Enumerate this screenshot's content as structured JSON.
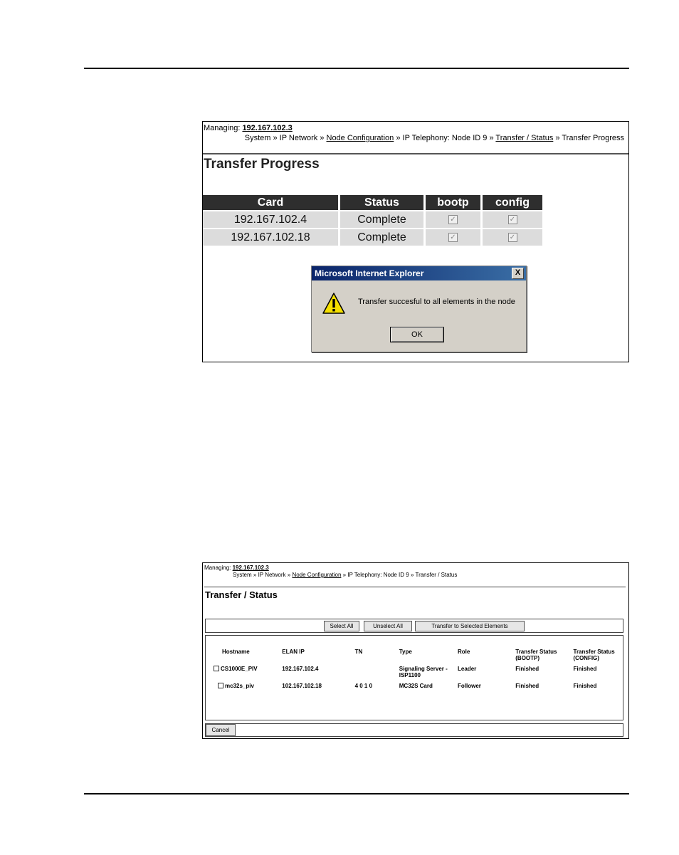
{
  "shot1": {
    "managing_label": "Managing:",
    "managing_ip": "192.167.102.3",
    "crumbs": {
      "system": "System »",
      "ipnetwork": "IP Network »",
      "nodeconfig": "Node Configuration",
      "sep1": "»",
      "iptel": "IP Telephony: Node ID 9 »",
      "transferstatus": "Transfer / Status",
      "sep2": "»",
      "current": "Transfer Progress"
    },
    "title": "Transfer Progress",
    "columns": [
      "Card",
      "Status",
      "bootp",
      "config"
    ],
    "rows": [
      {
        "card": "192.167.102.4",
        "status": "Complete"
      },
      {
        "card": "192.167.102.18",
        "status": "Complete"
      }
    ],
    "dialog": {
      "title": "Microsoft Internet Explorer",
      "close": "X",
      "message": "Transfer succesful to all elements in the node",
      "ok": "OK"
    }
  },
  "shot2": {
    "managing_label": "Managing:",
    "managing_ip": "192.167.102.3",
    "crumbs": {
      "pre": "System » IP Network »",
      "nodeconfig": "Node Configuration",
      "post": "» IP Telephony: Node ID 9 » Transfer / Status"
    },
    "title": "Transfer / Status",
    "buttons": {
      "select_all": "Select All",
      "unselect_all": "Unselect All",
      "transfer": "Transfer to Selected Elements",
      "cancel": "Cancel"
    },
    "columns": [
      "Hostname",
      "ELAN IP",
      "TN",
      "Type",
      "Role",
      "Transfer Status (BOOTP)",
      "Transfer Status (CONFIG)"
    ],
    "rows": [
      {
        "hostname": "CS1000E_PIV",
        "elan_ip": "192.167.102.4",
        "tn": "",
        "type": "Signaling Server - ISP1100",
        "role": "Leader",
        "bootp": "Finished",
        "config": "Finished"
      },
      {
        "hostname": "mc32s_piv",
        "elan_ip": "102.167.102.18",
        "tn": "4 0 1 0",
        "type": "MC32S Card",
        "role": "Follower",
        "bootp": "Finished",
        "config": "Finished"
      }
    ]
  }
}
